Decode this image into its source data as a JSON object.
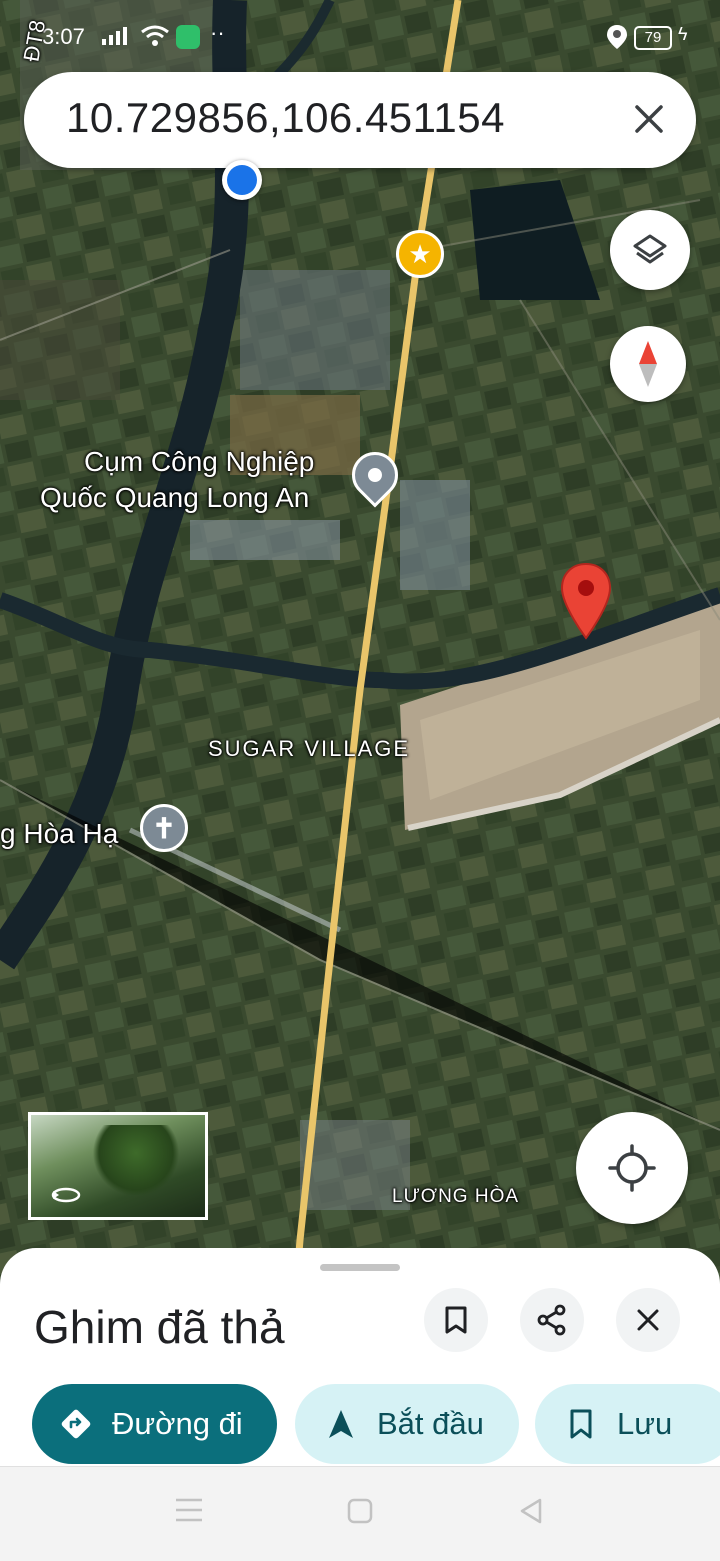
{
  "status_bar": {
    "time": "3:07",
    "battery": "79"
  },
  "search": {
    "query": "10.729856,106.451154"
  },
  "map_labels": {
    "poi_name_line1": "Cụm Công Nghiệp",
    "poi_name_line2": "Quốc Quang Long An",
    "area": "SUGAR VILLAGE",
    "church_place": "g Hòa Hạ",
    "district": "LƯƠNG HÒA",
    "road_edge": "ĐT8"
  },
  "sheet": {
    "title": "Ghim đã thả",
    "actions": [
      {
        "label": "Đường đi",
        "icon": "directions-icon"
      },
      {
        "label": "Bắt đầu",
        "icon": "navigation-arrow-icon"
      },
      {
        "label": "Lưu",
        "icon": "bookmark-icon"
      }
    ]
  },
  "colors": {
    "accent": "#0b6f7c",
    "chip_bg": "#d6f2f5",
    "pin": "#ea4335",
    "blue_dot": "#1a73e8"
  }
}
